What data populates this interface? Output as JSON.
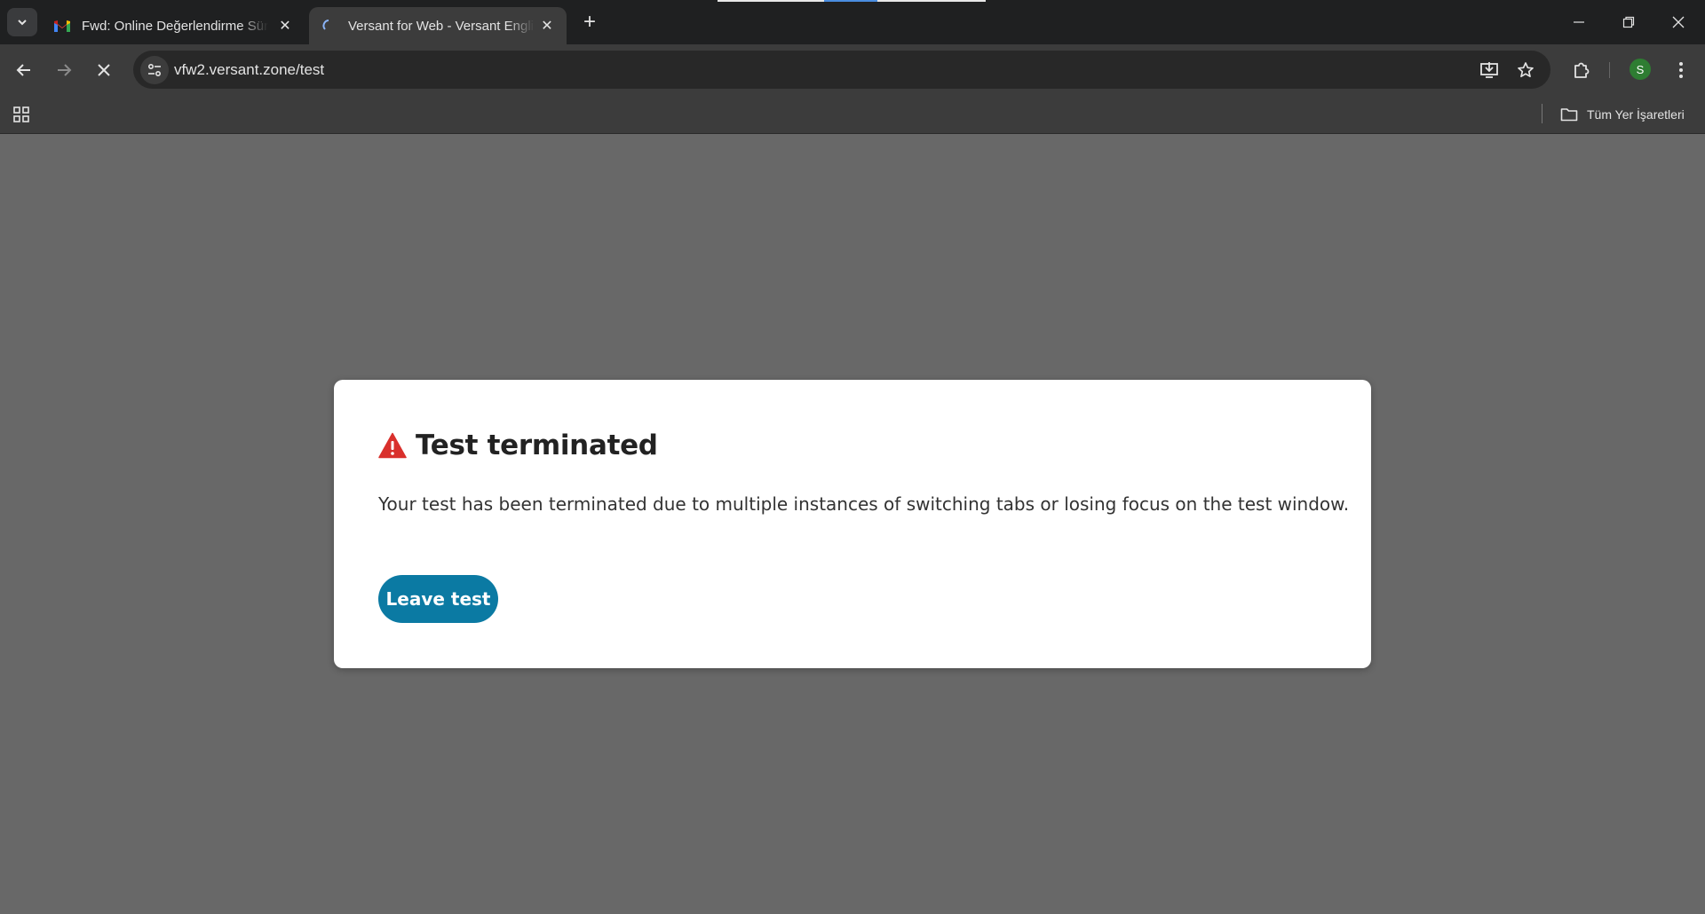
{
  "browser": {
    "tabs": [
      {
        "title": "Fwd: Online Değerlendirme Süreci",
        "active": false,
        "favicon": "gmail-icon"
      },
      {
        "title": "Versant for Web - Versant English",
        "active": true,
        "favicon": "loading-spinner-icon"
      }
    ],
    "url": "vfw2.versant.zone/test",
    "avatar_letter": "S",
    "bookmarks_all_label": "Tüm Yer İşaretleri",
    "colors": {
      "tabstrip": "#1f2021",
      "toolbar": "#3c3c3c",
      "page_overlay": "#686868",
      "avatar": "#2e7d32"
    }
  },
  "dialog": {
    "title": "Test terminated",
    "message": "Your test has been terminated due to multiple instances of switching tabs or losing focus on the test window.",
    "leave_label": "Leave test",
    "colors": {
      "warning": "#d9302c",
      "button": "#0b7aa3"
    }
  }
}
